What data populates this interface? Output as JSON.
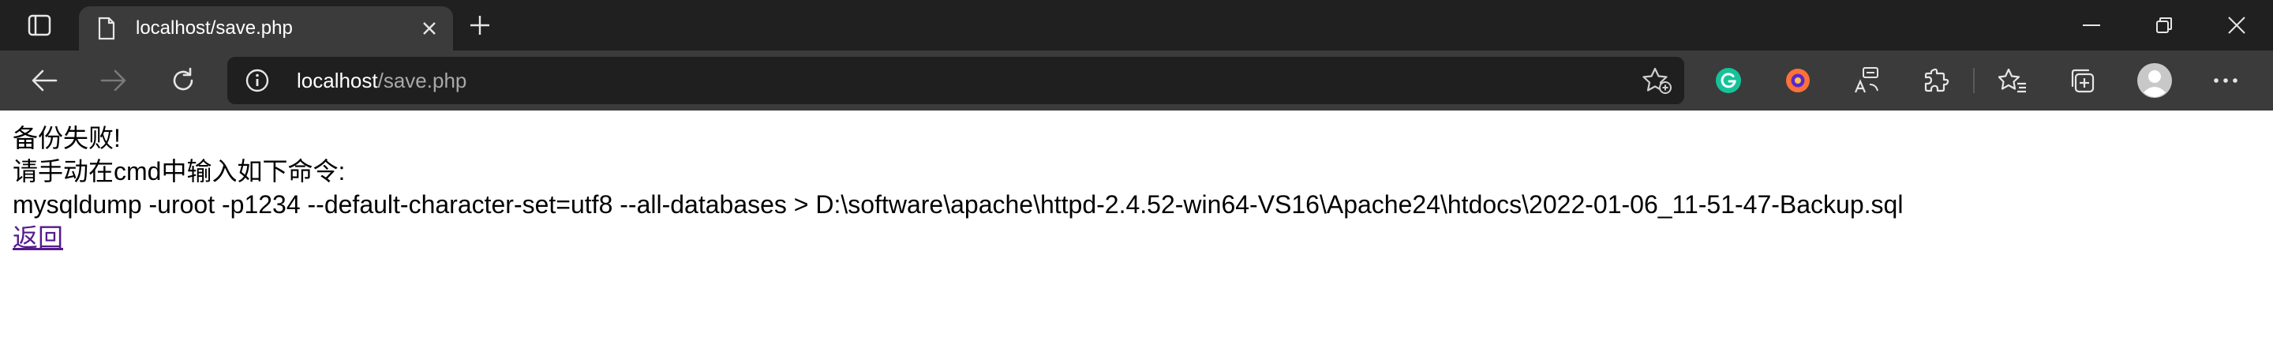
{
  "browser": {
    "tab": {
      "title": "localhost/save.php"
    },
    "address_bar": {
      "host": "localhost",
      "path": "/save.php"
    }
  },
  "icons": [
    "tab-actions-icon",
    "page-icon",
    "close-tab-icon",
    "new-tab-icon",
    "minimize-icon",
    "restore-icon",
    "close-window-icon",
    "back-icon",
    "forward-icon",
    "refresh-icon",
    "site-info-icon",
    "add-favorite-icon",
    "grammarly-icon",
    "firefox-relay-icon",
    "translate-icon",
    "extensions-icon",
    "favorites-icon",
    "collections-icon",
    "profile-avatar-icon",
    "more-menu-icon"
  ],
  "colors": {
    "titlebar": "#202020",
    "toolbar": "#3b3b3b",
    "omnibox": "#1f1f1f",
    "link": "#551a8b",
    "grammarly": "#15c39a"
  },
  "page": {
    "line1": "备份失败!",
    "line2": "请手动在cmd中输入如下命令:",
    "command": "mysqldump -uroot -p1234 --default-character-set=utf8 --all-databases > D:\\software\\apache\\httpd-2.4.52-win64-VS16\\Apache24\\htdocs\\2022-01-06_11-51-47-Backup.sql",
    "back_link": "返回"
  }
}
